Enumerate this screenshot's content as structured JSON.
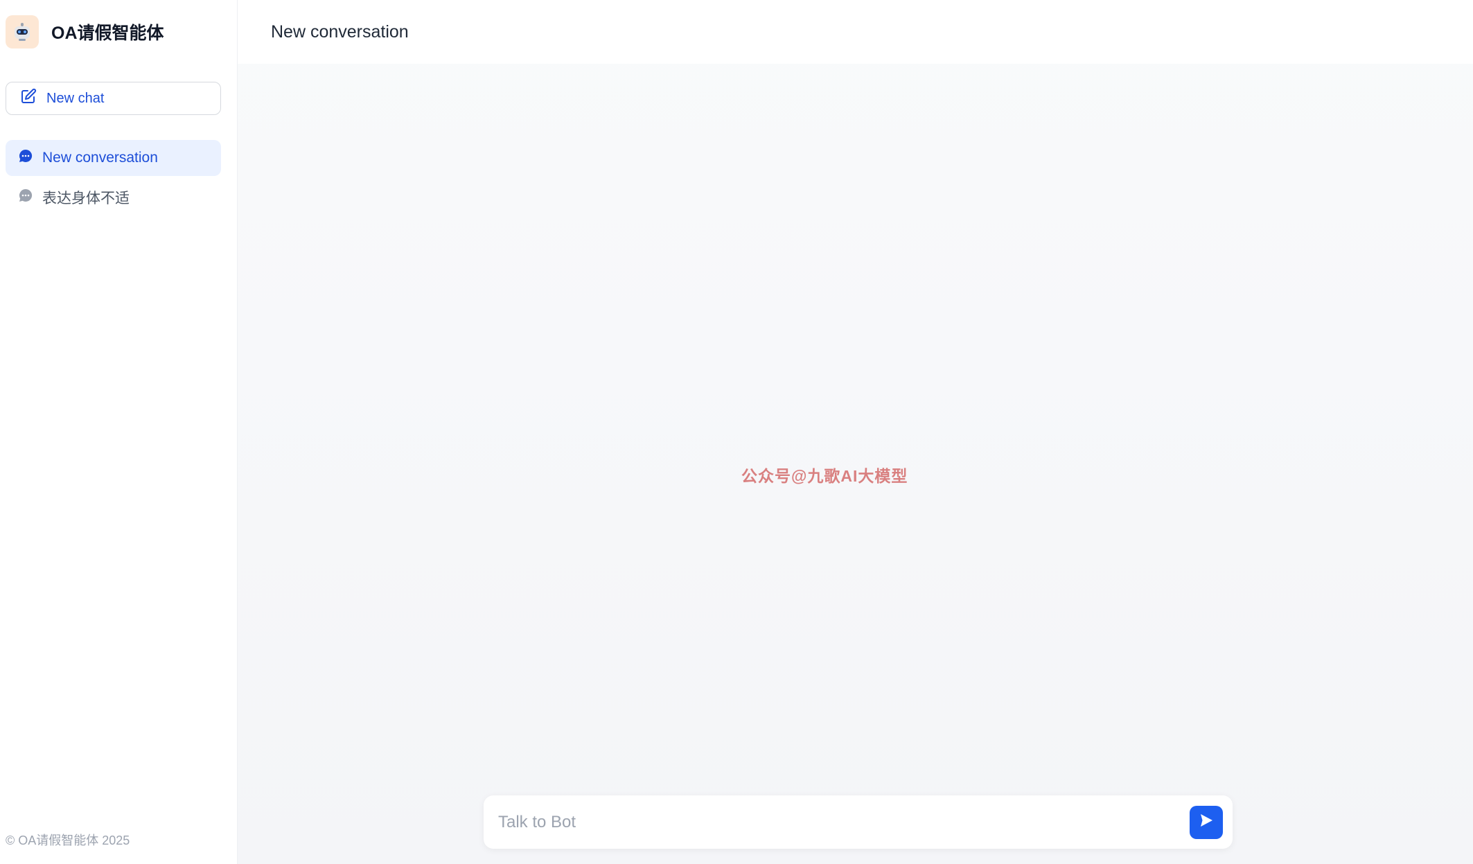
{
  "app": {
    "name": "OA请假智能体",
    "logo_icon": "robot-icon"
  },
  "sidebar": {
    "new_chat_label": "New chat",
    "conversations": [
      {
        "label": "New conversation",
        "active": true,
        "icon": "chat-bubble-icon"
      },
      {
        "label": "表达身体不适",
        "active": false,
        "icon": "chat-bubble-icon"
      }
    ],
    "footer": "© OA请假智能体 2025"
  },
  "main": {
    "title": "New conversation",
    "watermark": "公众号@九歌AI大模型",
    "input": {
      "placeholder": "Talk to Bot",
      "value": ""
    }
  },
  "colors": {
    "accent": "#1d5ff0",
    "active_bg": "#eaf1ff",
    "watermark": "#d98080"
  }
}
